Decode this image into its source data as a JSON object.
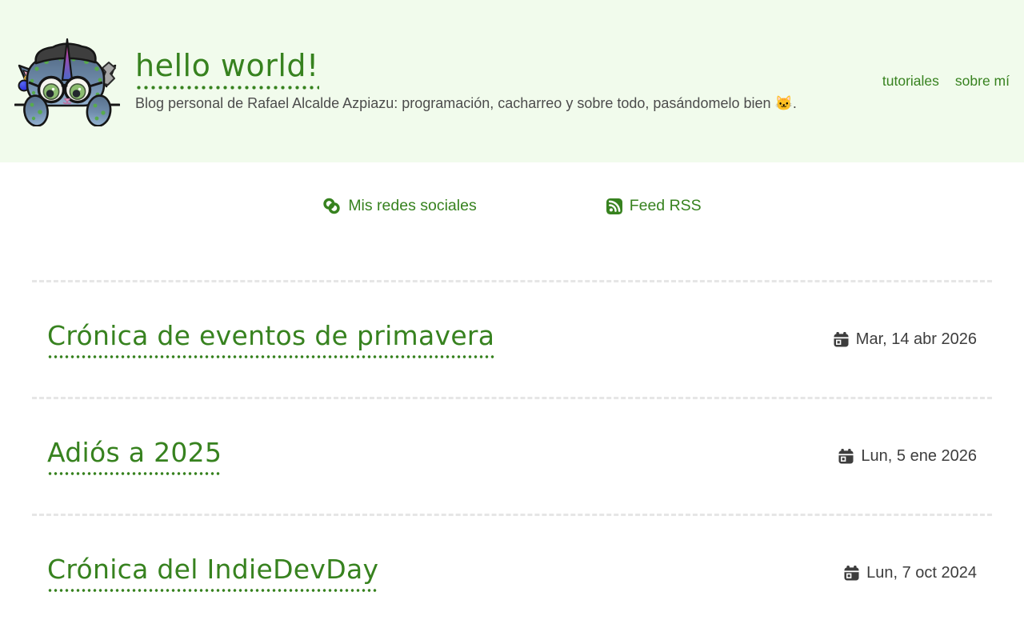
{
  "header": {
    "title": "hello world!",
    "subtitle": "Blog personal de Rafael Alcalde Azpiazu: programación, cacharreo y sobre todo, pasándomelo bien 🐱.",
    "nav": [
      {
        "label": "tutoriales"
      },
      {
        "label": "sobre mí"
      }
    ]
  },
  "links": {
    "social_label": "Mis redes sociales",
    "rss_label": "Feed RSS"
  },
  "posts": [
    {
      "title": "Crónica de eventos de primavera",
      "date": "Mar, 14 abr 2026"
    },
    {
      "title": "Adiós a 2025",
      "date": "Lun, 5 ene 2026"
    },
    {
      "title": "Crónica del IndieDevDay",
      "date": "Lun, 7 oct 2024"
    }
  ],
  "icons": {
    "logo": "mascot-cat-unicorn-peeking",
    "social": "link-icon",
    "rss": "rss-icon",
    "date": "calendar-icon"
  },
  "colors": {
    "accent": "#37821f",
    "header_bg": "#f1fbec",
    "separator": "#e6e6e6",
    "subtitle_text": "#4c4c4c",
    "date_text": "#3d3d3d"
  }
}
